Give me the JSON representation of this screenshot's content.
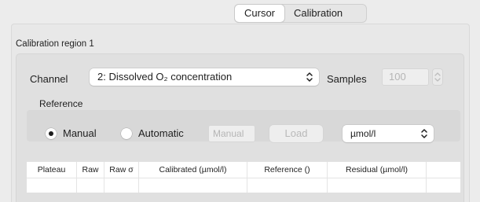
{
  "tabs": [
    {
      "label": "Cursor",
      "active": true
    },
    {
      "label": "Calibration",
      "active": false
    }
  ],
  "region_title": "Calibration region 1",
  "channel": {
    "label": "Channel",
    "value": "2: Dissolved O₂ concentration"
  },
  "samples": {
    "label": "Samples",
    "value": "100"
  },
  "reference": {
    "label": "Reference",
    "manual_label": "Manual",
    "automatic_label": "Automatic",
    "selected": "Manual",
    "manual_field_placeholder": "Manual",
    "load_label": "Load",
    "unit": "µmol/l"
  },
  "table": {
    "headers": [
      "Plateau",
      "Raw",
      "Raw σ",
      "Calibrated (µmol/l)",
      "Reference ()",
      "Residual (µmol/l)",
      ""
    ]
  },
  "colors": {
    "window_bg": "#ececec",
    "group_bg": "#e0e0e0",
    "disabled_text": "#b5b5b5"
  }
}
